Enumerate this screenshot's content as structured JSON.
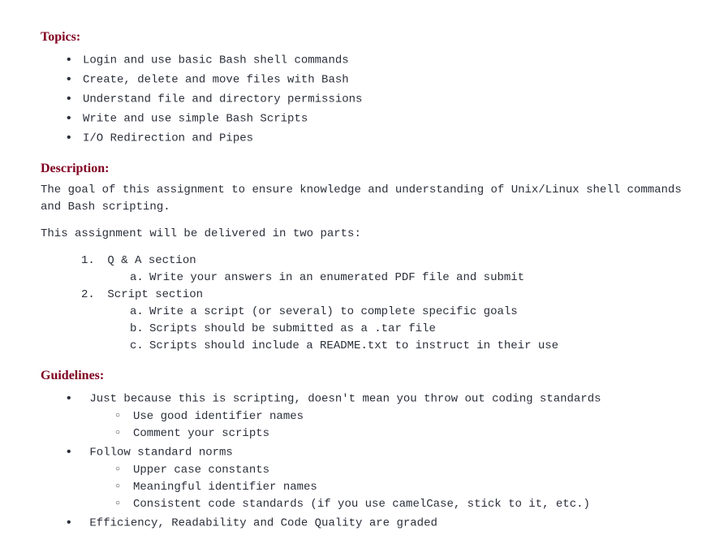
{
  "topics": {
    "heading": "Topics:",
    "items": [
      "Login and use basic Bash shell commands",
      "Create, delete and move files with Bash",
      "Understand file and directory permissions",
      "Write and use simple Bash Scripts",
      "I/O Redirection and Pipes"
    ]
  },
  "description": {
    "heading": "Description:",
    "para1": "The goal of this assignment to ensure knowledge and understanding of Unix/Linux shell commands and Bash scripting.",
    "para2": "This assignment will be delivered in two parts:",
    "parts": [
      {
        "label": "Q & A section",
        "sub": [
          "Write your answers in an enumerated PDF file and submit"
        ]
      },
      {
        "label": "Script section",
        "sub": [
          "Write a script (or several) to complete specific goals",
          "Scripts should be submitted as a .tar file",
          "Scripts should include a README.txt to instruct in their use"
        ]
      }
    ]
  },
  "guidelines": {
    "heading": "Guidelines:",
    "items": [
      {
        "text": "Just because this is scripting, doesn't mean you throw out coding standards",
        "sub": [
          "Use good identifier names",
          "Comment your scripts"
        ]
      },
      {
        "text": "Follow standard norms",
        "sub": [
          "Upper case constants",
          "Meaningful identifier names",
          "Consistent code standards (if you use camelCase, stick to it, etc.)"
        ]
      },
      {
        "text": "Efficiency, Readability and Code Quality are graded",
        "sub": []
      }
    ]
  }
}
